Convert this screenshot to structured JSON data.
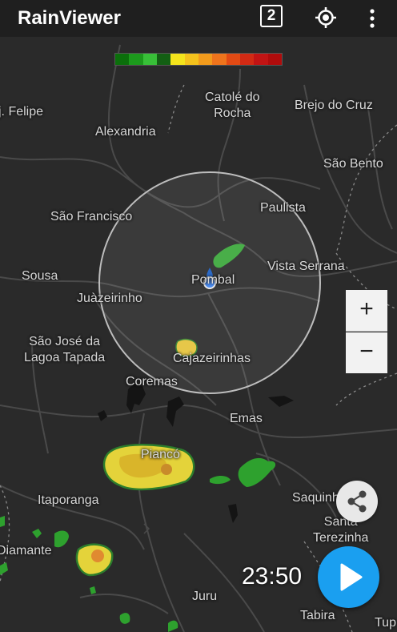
{
  "app": {
    "title": "RainViewer",
    "badge_number": "2"
  },
  "icons": {
    "locate": "crosshair-icon",
    "more": "more-vert-icon",
    "share": "share-icon",
    "play": "play-icon",
    "user_location": "user-location-dot"
  },
  "zoom": {
    "in_label": "+",
    "out_label": "−"
  },
  "player": {
    "time": "23:50"
  },
  "legend_colors": [
    "#0b6f0b",
    "#1c9a1c",
    "#38c038",
    "#135f13",
    "#f4e41c",
    "#f4c21c",
    "#f29b1c",
    "#ef741c",
    "#e24a14",
    "#d22a14",
    "#c21414",
    "#b00c0c"
  ],
  "places": {
    "felipe": "j. Felipe",
    "catole": "Catolé do\nRocha",
    "brejo": "Brejo do Cruz",
    "alexandria": "Alexandria",
    "sao_bento": "São Bento",
    "sao_francisco": "São Francisco",
    "paulista": "Paulista",
    "vista_serrana": "Vista Serrana",
    "sousa": "Sousa",
    "pombal": "Pombal",
    "juazeirinho": "Juàzeirinho",
    "sao_jose": "São José da\nLagoa Tapada",
    "cajazeirinhas": "Cajazeirinhas",
    "coremas": "Coremas",
    "emas": "Emas",
    "pianco": "Piancó",
    "itaporanga": "Itaporanga",
    "saquinho": "Saquinho",
    "santa_terezinha": "Santa\nTerezinha",
    "diamante": "Diamante",
    "juru": "Juru",
    "tabira": "Tabira",
    "tup": "Tup"
  }
}
